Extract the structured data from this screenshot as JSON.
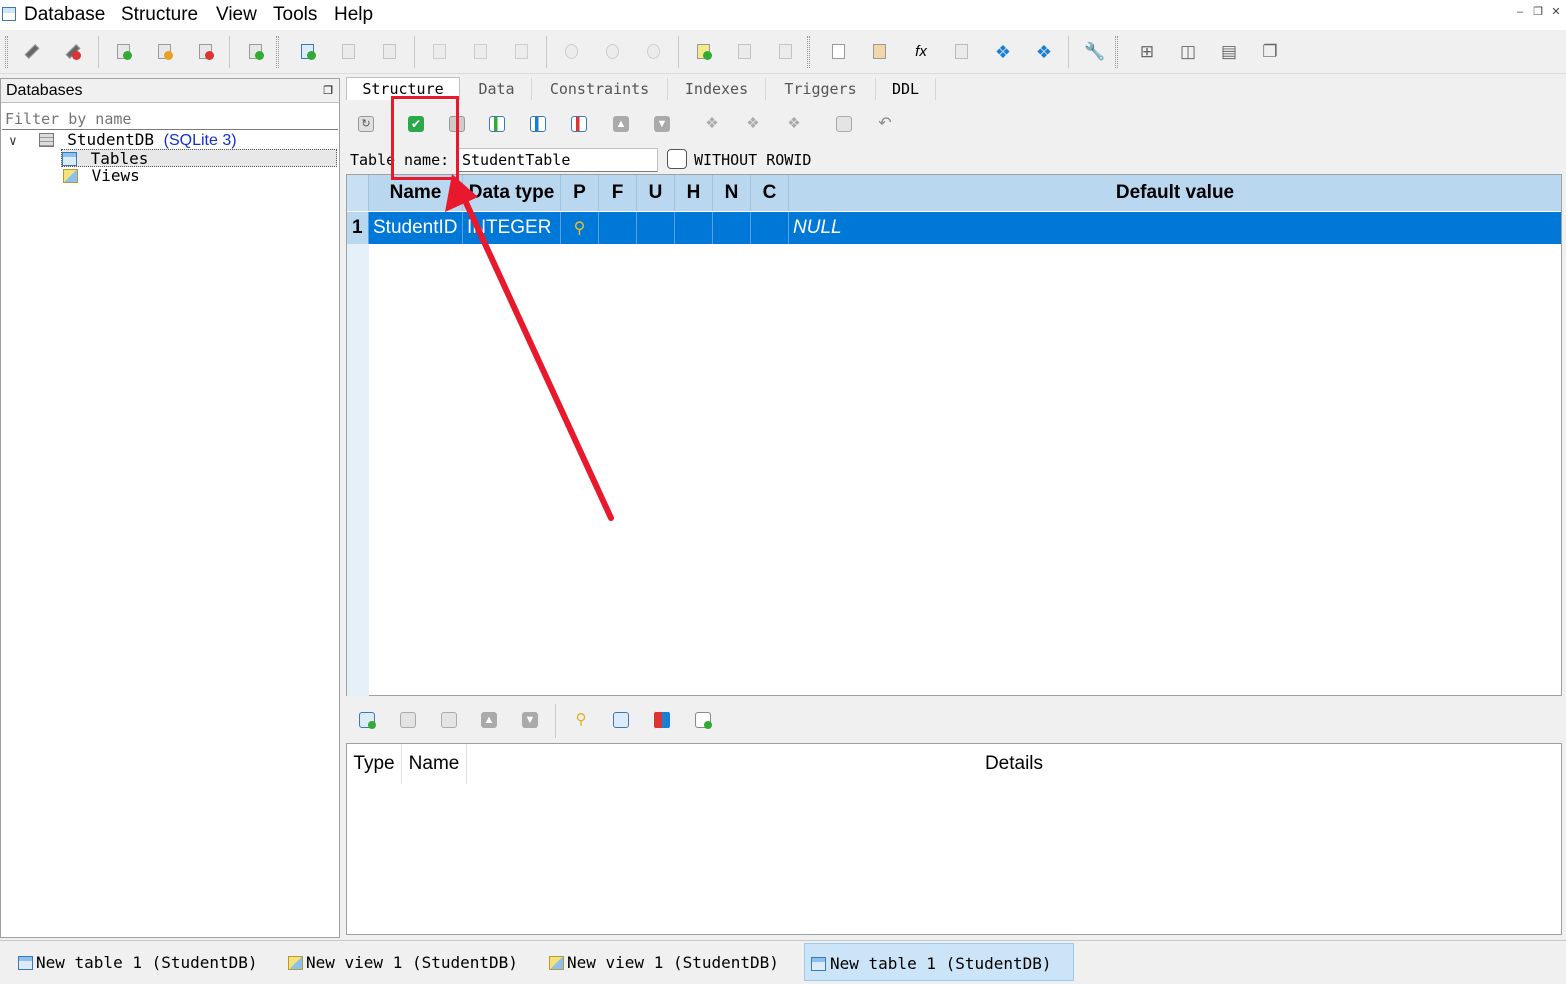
{
  "menu": [
    "Database",
    "Structure",
    "View",
    "Tools",
    "Help"
  ],
  "window_controls": [
    "minimize-icon",
    "restore-icon",
    "close-icon"
  ],
  "db_panel": {
    "title": "Databases",
    "filter_placeholder": "Filter by name",
    "tree": {
      "db_name": "StudentDB",
      "db_type": "(SQLite 3)",
      "children": [
        "Tables",
        "Views"
      ]
    }
  },
  "tabs": [
    "Structure",
    "Data",
    "Constraints",
    "Indexes",
    "Triggers",
    "DDL"
  ],
  "structure": {
    "table_label": "Table",
    "name_label": "name:",
    "table_name": "StudentTable",
    "without_rowid": "WITHOUT ROWID",
    "without_rowid_checked": false,
    "columns_header": [
      "Name",
      "Data type",
      "P",
      "F",
      "U",
      "H",
      "N",
      "C",
      "Default value"
    ],
    "rows": [
      {
        "num": "1",
        "name": "StudentID",
        "type": "INTEGER",
        "pk": true,
        "default": "NULL"
      }
    ]
  },
  "constraints_grid": {
    "headers": [
      "Type",
      "Name",
      "Details"
    ]
  },
  "taskbar": [
    {
      "label": "New table 1 (StudentDB)",
      "icon": "table-icon",
      "active": false
    },
    {
      "label": "New view 1 (StudentDB)",
      "icon": "view-icon",
      "active": false
    },
    {
      "label": "New view 1 (StudentDB)",
      "icon": "view-icon",
      "active": false
    },
    {
      "label": "New table 1 (StudentDB)",
      "icon": "table-icon",
      "active": true
    }
  ],
  "colors": {
    "selection": "#0078d7",
    "header": "#b9d8f0",
    "annotation": "#e8192c"
  }
}
